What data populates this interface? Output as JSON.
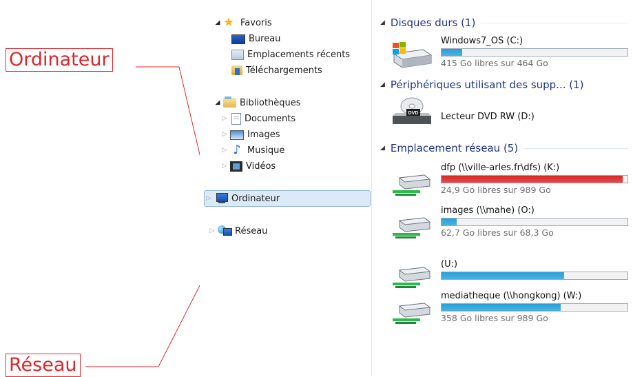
{
  "callouts": {
    "ordinateur": "Ordinateur",
    "reseau": "Réseau"
  },
  "nav": {
    "favoris": {
      "label": "Favoris",
      "items": [
        "Bureau",
        "Emplacements récents",
        "Téléchargements"
      ]
    },
    "bibliotheques": {
      "label": "Bibliothèques",
      "items": [
        "Documents",
        "Images",
        "Musique",
        "Vidéos"
      ]
    },
    "ordinateur": "Ordinateur",
    "reseau": "Réseau"
  },
  "groups": {
    "hdd": "Disques durs (1)",
    "removable": "Périphériques utilisant des supp... (1)",
    "network": "Emplacement réseau (5)"
  },
  "drives": {
    "c": {
      "name": "Windows7_OS (C:)",
      "free": "415 Go libres sur 464 Go",
      "used_fraction": 0.11
    },
    "dvd": {
      "name": "Lecteur DVD RW (D:)",
      "badge": "DVD"
    },
    "k": {
      "name": "dfp (\\\\ville-arles.fr\\dfs) (K:)",
      "free": "24,9 Go libres sur 989 Go",
      "used_fraction": 0.975
    },
    "o": {
      "name": "images (\\\\mahe) (O:)",
      "free": "62,7 Go libres sur 68,3 Go",
      "used_fraction": 0.08
    },
    "u": {
      "name": "(U:)",
      "used_fraction": 0.66
    },
    "w": {
      "name": "mediatheque (\\\\hongkong) (W:)",
      "free": "358 Go libres sur 989 Go",
      "used_fraction": 0.64
    }
  },
  "colors": {
    "bar_normal": "#26a0da",
    "bar_full": "#da2626",
    "callout": "#e0262a",
    "group_header": "#1e3287"
  }
}
